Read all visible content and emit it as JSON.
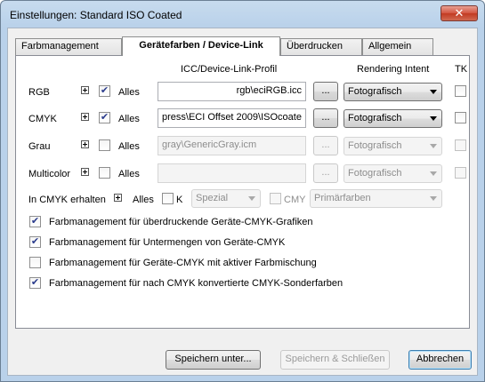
{
  "window": {
    "title": "Einstellungen:  Standard ISO Coated",
    "close": "✕"
  },
  "tabs": [
    {
      "label": "Farbmanagement"
    },
    {
      "label": "Gerätefarben / Device-Link"
    },
    {
      "label": "Überdrucken"
    },
    {
      "label": "Allgemein"
    }
  ],
  "columns": {
    "profile": "ICC/Device-Link-Profil",
    "intent": "Rendering Intent",
    "tk": "TK"
  },
  "rows": [
    {
      "label": "RGB",
      "alles_label": "Alles",
      "alles_checked": true,
      "profile": "rgb\\eciRGB.icc",
      "browse": "...",
      "intent": "Fotografisch",
      "tk_checked": false,
      "enabled": true
    },
    {
      "label": "CMYK",
      "alles_label": "Alles",
      "alles_checked": true,
      "profile": "press\\ECI Offset 2009\\ISOcoate",
      "browse": "...",
      "intent": "Fotografisch",
      "tk_checked": false,
      "enabled": true
    },
    {
      "label": "Grau",
      "alles_label": "Alles",
      "alles_checked": false,
      "profile": "gray\\GenericGray.icm",
      "browse": "...",
      "intent": "Fotografisch",
      "tk_checked": false,
      "enabled": false
    },
    {
      "label": "Multicolor",
      "alles_label": "Alles",
      "alles_checked": false,
      "profile": "",
      "browse": "...",
      "intent": "Fotografisch",
      "tk_checked": false,
      "enabled": false
    }
  ],
  "preserve": {
    "label": "In CMYK erhalten",
    "alles_label": "Alles",
    "k_label": "K",
    "k_select": "Spezial",
    "cmy_label": "CMY",
    "cmy_select": "Primärfarben"
  },
  "options": [
    {
      "label": "Farbmanagement für überdruckende Geräte-CMYK-Grafiken",
      "checked": true
    },
    {
      "label": "Farbmanagement für Untermengen von Geräte-CMYK",
      "checked": true
    },
    {
      "label": "Farbmanagement für Geräte-CMYK mit aktiver Farbmischung",
      "checked": false
    },
    {
      "label": "Farbmanagement für nach CMYK konvertierte CMYK-Sonderfarben",
      "checked": true
    }
  ],
  "buttons": {
    "save_as": "Speichern unter...",
    "save_close": "Speichern & Schließen",
    "cancel": "Abbrechen"
  },
  "check_glyph": "✔"
}
